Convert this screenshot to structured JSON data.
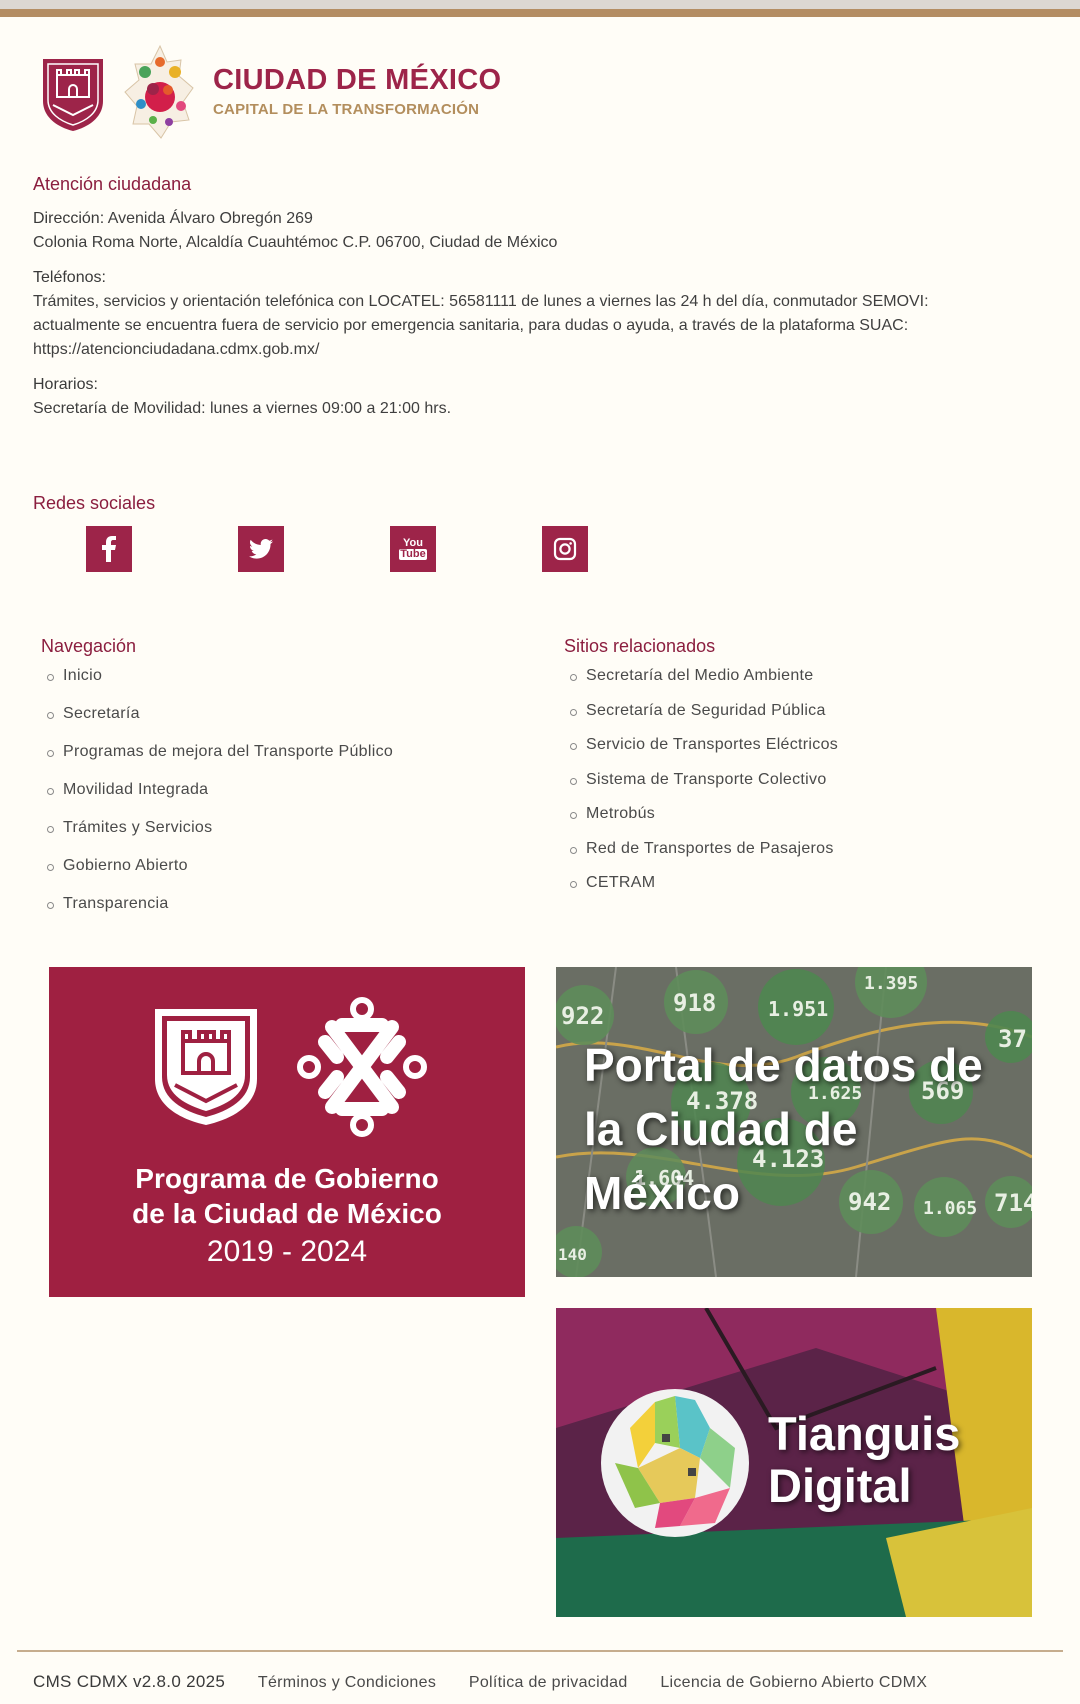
{
  "header": {
    "title": "CIUDAD DE MÉXICO",
    "subtitle": "CAPITAL DE LA TRANSFORMACIÓN"
  },
  "contact": {
    "heading": "Atención ciudadana",
    "address_label": "Dirección:",
    "address_line1": "Avenida Álvaro Obregón 269",
    "address_line2": "Colonia Roma Norte, Alcaldía Cuauhtémoc C.P. 06700, Ciudad de México",
    "phones_label": "Teléfonos:",
    "phones_text": "Trámites, servicios y orientación telefónica con LOCATEL: 56581111 de lunes a viernes las 24 h del día, conmutador SEMOVI: actualmente se encuentra fuera de servicio por emergencia sanitaria, para dudas o ayuda, a través de la plataforma SUAC: https://atencionciudadana.cdmx.gob.mx/",
    "hours_label": "Horarios:",
    "hours_text": "Secretaría de Movilidad: lunes a viernes 09:00 a 21:00 hrs."
  },
  "social": {
    "heading": "Redes sociales",
    "items": [
      "facebook-icon",
      "twitter-icon",
      "youtube-icon",
      "instagram-icon"
    ],
    "youtube_glyph_top": "You",
    "youtube_glyph_bottom": "Tube"
  },
  "navigation": {
    "heading": "Navegación",
    "items": [
      "Inicio",
      "Secretaría",
      "Programas de mejora del Transporte Público",
      "Movilidad Integrada",
      "Trámites y Servicios",
      "Gobierno Abierto",
      "Transparencia"
    ]
  },
  "related": {
    "heading": "Sitios relacionados",
    "items": [
      "Secretaría del Medio Ambiente",
      "Secretaría de Seguridad Pública",
      "Servicio de Transportes Eléctricos",
      "Sistema de Transporte Colectivo",
      "Metrobús",
      "Red de Transportes de Pasajeros",
      "CETRAM"
    ]
  },
  "banners": {
    "program": {
      "line1": "Programa de Gobierno",
      "line2": "de la Ciudad de México",
      "years": "2019 - 2024"
    },
    "data_portal": {
      "title": "Portal de datos de la Ciudad de México",
      "map_numbers": [
        "922",
        "918",
        "1.951",
        "1.395",
        "37",
        "4.378",
        "1.625",
        "569",
        "4.123",
        "942",
        "1.065",
        "714",
        "1.604",
        "140"
      ]
    },
    "tianguis": {
      "line1": "Tianguis",
      "line2": "Digital"
    }
  },
  "footer": {
    "version": "CMS CDMX v2.8.0 2025",
    "links": [
      "Términos y Condiciones",
      "Política de privacidad",
      "Licencia de Gobierno Abierto CDMX"
    ]
  },
  "colors": {
    "brand": "#9d2449",
    "gold": "#b38e5d",
    "background": "#fffdf7"
  }
}
